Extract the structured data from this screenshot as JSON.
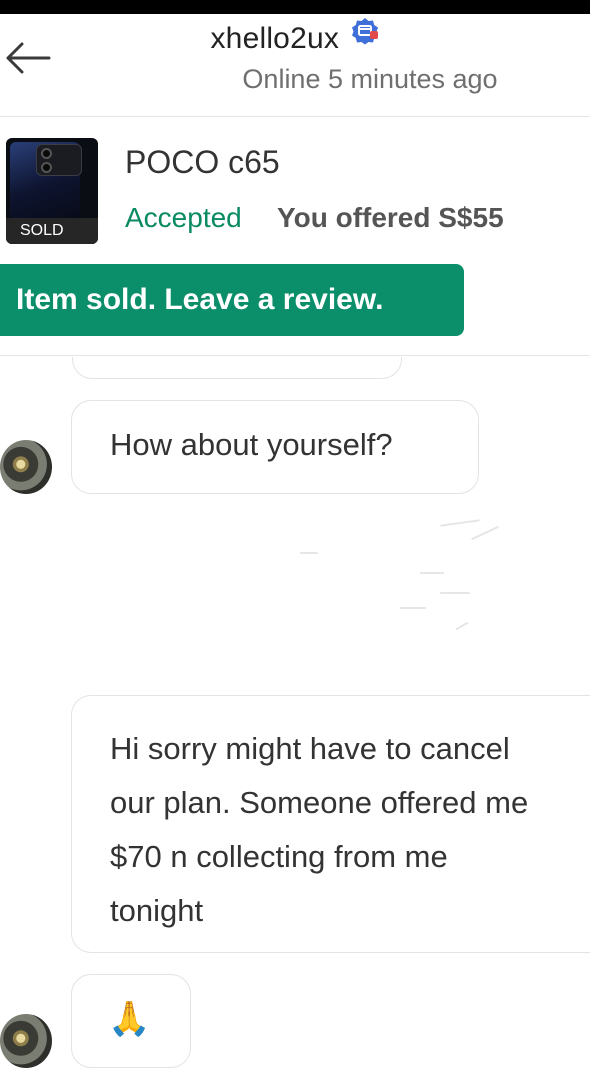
{
  "header": {
    "username": "xhello2ux",
    "status": "Online 5 minutes ago"
  },
  "listing": {
    "title": "POCO c65",
    "sold_tag": "SOLD",
    "accepted": "Accepted",
    "offer": "You offered S$55",
    "review_button": "Item sold. Leave a review."
  },
  "messages": [
    {
      "text": "How about yourself?"
    },
    {
      "text": "Hi sorry might have to cancel\nour plan. Someone offered me\n$70 n collecting from me\ntonight"
    },
    {
      "text": "🙏"
    }
  ],
  "colors": {
    "accent": "#0b8e6a",
    "accepted": "#0a8a62",
    "sold_tag_bg": "#262626"
  },
  "icons": [
    "back-arrow-icon",
    "verified-badge-icon"
  ]
}
